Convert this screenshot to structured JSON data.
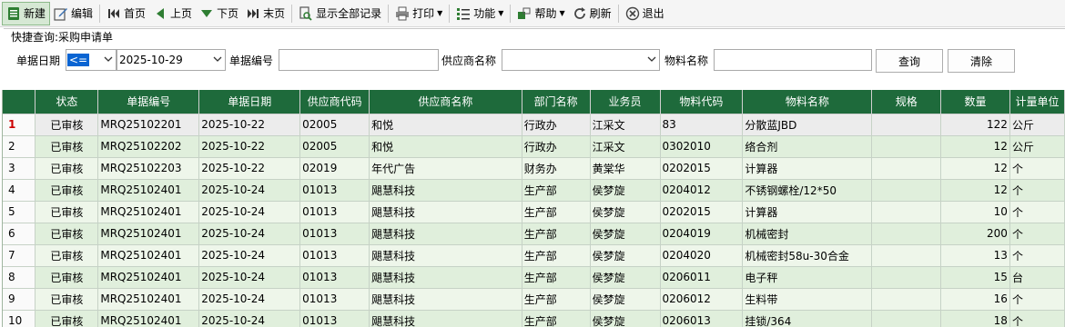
{
  "toolbar": {
    "items": [
      {
        "label": "新建",
        "icon": "new-doc-icon"
      },
      {
        "label": "编辑",
        "icon": "edit-icon"
      },
      {
        "label": "首页",
        "icon": "first-page-icon"
      },
      {
        "label": "上页",
        "icon": "prev-page-icon"
      },
      {
        "label": "下页",
        "icon": "next-page-icon"
      },
      {
        "label": "末页",
        "icon": "last-page-icon"
      },
      {
        "label": "显示全部记录",
        "icon": "show-all-icon"
      },
      {
        "label": "打印",
        "icon": "print-icon"
      },
      {
        "label": "功能",
        "icon": "function-icon"
      },
      {
        "label": "帮助",
        "icon": "help-icon"
      },
      {
        "label": "刷新",
        "icon": "refresh-icon"
      },
      {
        "label": "退出",
        "icon": "exit-icon"
      }
    ]
  },
  "quick_search": {
    "title": "快捷查询:采购申请单",
    "date_label": "单据日期",
    "date_operator": "<=",
    "date_value": "2025-10-29",
    "doc_no_label": "单据编号",
    "doc_no_value": "",
    "supplier_label": "供应商名称",
    "supplier_value": "",
    "material_label": "物料名称",
    "material_value": "",
    "query_button": "查询",
    "clear_button": "清除"
  },
  "grid": {
    "columns": [
      "",
      "状态",
      "单据编号",
      "单据日期",
      "供应商代码",
      "供应商名称",
      "部门名称",
      "业务员",
      "物料代码",
      "物料名称",
      "规格",
      "数量",
      "计量单位"
    ],
    "rows": [
      [
        "1",
        "已审核",
        "MRQ25102201",
        "2025-10-22",
        "02005",
        "和悦",
        "行政办",
        "江采文",
        "83",
        "分散蓝JBD",
        "",
        "122",
        "公斤"
      ],
      [
        "2",
        "已审核",
        "MRQ25102202",
        "2025-10-22",
        "02005",
        "和悦",
        "行政办",
        "江采文",
        "0302010",
        "络合剂",
        "",
        "12",
        "公斤"
      ],
      [
        "3",
        "已审核",
        "MRQ25102203",
        "2025-10-22",
        "02019",
        "年代广告",
        "财务办",
        "黄棠华",
        "0202015",
        "计算器",
        "",
        "12",
        "个"
      ],
      [
        "4",
        "已审核",
        "MRQ25102401",
        "2025-10-24",
        "01013",
        "飓慧科技",
        "生产部",
        "侯梦旋",
        "0204012",
        "不锈钢螺栓/12*50",
        "",
        "12",
        "个"
      ],
      [
        "5",
        "已审核",
        "MRQ25102401",
        "2025-10-24",
        "01013",
        "飓慧科技",
        "生产部",
        "侯梦旋",
        "0202015",
        "计算器",
        "",
        "10",
        "个"
      ],
      [
        "6",
        "已审核",
        "MRQ25102401",
        "2025-10-24",
        "01013",
        "飓慧科技",
        "生产部",
        "侯梦旋",
        "0204019",
        "机械密封",
        "",
        "200",
        "个"
      ],
      [
        "7",
        "已审核",
        "MRQ25102401",
        "2025-10-24",
        "01013",
        "飓慧科技",
        "生产部",
        "侯梦旋",
        "0204020",
        "机械密封58u-30合金",
        "",
        "13",
        "个"
      ],
      [
        "8",
        "已审核",
        "MRQ25102401",
        "2025-10-24",
        "01013",
        "飓慧科技",
        "生产部",
        "侯梦旋",
        "0206011",
        "电子秤",
        "",
        "15",
        "台"
      ],
      [
        "9",
        "已审核",
        "MRQ25102401",
        "2025-10-24",
        "01013",
        "飓慧科技",
        "生产部",
        "侯梦旋",
        "0206012",
        "生料带",
        "",
        "16",
        "个"
      ],
      [
        "10",
        "已审核",
        "MRQ25102401",
        "2025-10-24",
        "01013",
        "飓慧科技",
        "生产部",
        "侯梦旋",
        "0206013",
        "挂锁/364",
        "",
        "18",
        "个"
      ]
    ]
  },
  "colors": {
    "header_bg": "#1e6a3b",
    "row_odd": "#eef6ea",
    "row_even": "#e0efdc",
    "accent_selection": "#0a64d2"
  }
}
